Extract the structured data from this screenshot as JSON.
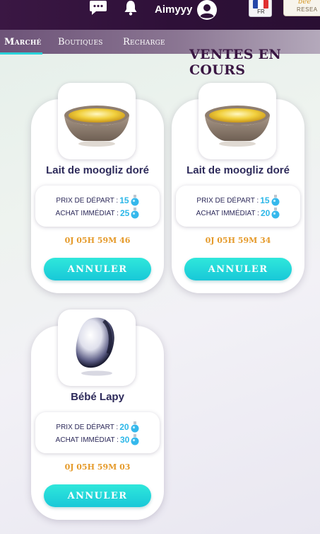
{
  "header": {
    "username": "Aimyyy",
    "language": "FR",
    "research_logo": "RESEA",
    "research_logo_brand": "bee"
  },
  "nav": {
    "items": [
      {
        "label": "Marché",
        "active": true
      },
      {
        "label": "Boutiques",
        "active": false
      },
      {
        "label": "Recharge",
        "active": false
      }
    ]
  },
  "section": {
    "title": "VENTES EN COURS"
  },
  "colors": {
    "accent": "#2ad2d9",
    "price_value": "#2cb7e8",
    "timer": "#e59a2a",
    "title": "#3a1743"
  },
  "sales": [
    {
      "name": "Lait de moogliz doré",
      "icon": "golden-milk-bowl",
      "start_label": "PRIX DE DÉPART :",
      "start_price": "15",
      "buyout_label": "ACHAT IMMÉDIAT :",
      "buyout_price": "25",
      "timer": "0J 05H 59M 46",
      "button": "ANNULER"
    },
    {
      "name": "Lait de moogliz doré",
      "icon": "golden-milk-bowl",
      "start_label": "PRIX DE DÉPART :",
      "start_price": "15",
      "buyout_label": "ACHAT IMMÉDIAT :",
      "buyout_price": "20",
      "timer": "0J 05H 59M 34",
      "button": "ANNULER"
    },
    {
      "name": "Bébé Lapy",
      "icon": "lapy-egg",
      "start_label": "PRIX DE DÉPART :",
      "start_price": "20",
      "buyout_label": "ACHAT IMMÉDIAT :",
      "buyout_price": "30",
      "timer": "0J 05H 59M 03",
      "button": "ANNULER"
    }
  ]
}
